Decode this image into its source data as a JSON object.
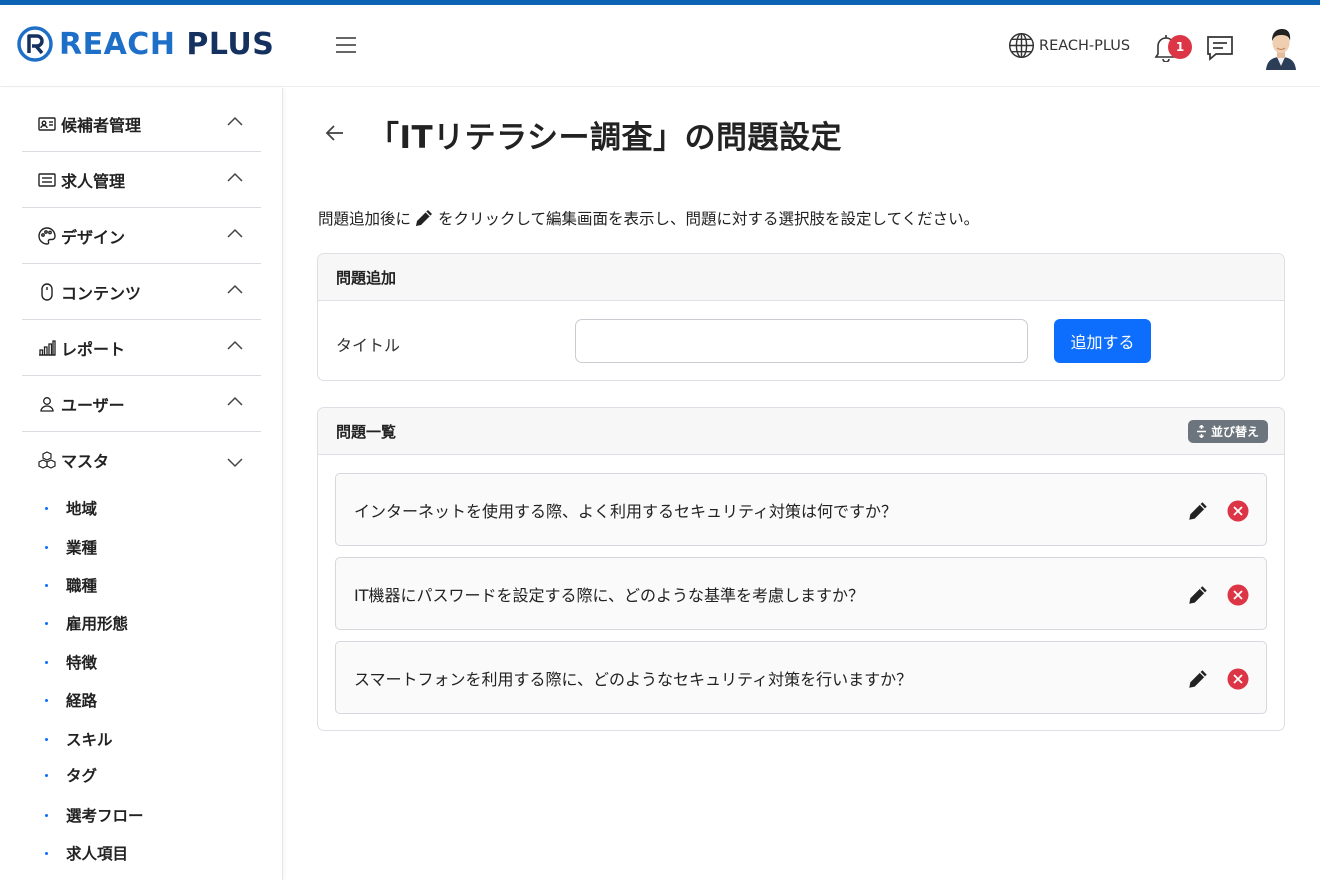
{
  "header": {
    "logo_reach": "REACH",
    "logo_plus": "PLUS",
    "org_name": "REACH-PLUS",
    "notification_count": "1"
  },
  "sidebar": {
    "items": [
      {
        "label": "候補者管理",
        "icon": "id-card-icon"
      },
      {
        "label": "求人管理",
        "icon": "list-icon"
      },
      {
        "label": "デザイン",
        "icon": "palette-icon"
      },
      {
        "label": "コンテンツ",
        "icon": "mouse-icon"
      },
      {
        "label": "レポート",
        "icon": "bar-chart-icon"
      },
      {
        "label": "ユーザー",
        "icon": "person-icon"
      },
      {
        "label": "マスタ",
        "icon": "boxes-icon"
      }
    ],
    "sub_items": [
      "地域",
      "業種",
      "職種",
      "雇用形態",
      "特徴",
      "経路",
      "スキル",
      "タグ",
      "選考フロー",
      "求人項目"
    ]
  },
  "page": {
    "title": "「ITリテラシー調査」の問題設定",
    "desc_before": "問題追加後に",
    "desc_after": "をクリックして編集画面を表示し、問題に対する選択肢を設定してください。"
  },
  "add_card": {
    "heading": "問題追加",
    "field_label": "タイトル",
    "input_value": "",
    "button_label": "追加する"
  },
  "list_card": {
    "heading": "問題一覧",
    "sort_label": "並び替え",
    "questions": [
      "インターネットを使用する際、よく利用するセキュリティ対策は何ですか？",
      "IT機器にパスワードを設定する際に、どのような基準を考慮しますか？",
      "スマートフォンを利用する際に、どのようなセキュリティ対策を行いますか？"
    ]
  },
  "colors": {
    "primary": "#0d6efd",
    "danger": "#dc3545",
    "top_line": "#0d63b3",
    "logo_blue": "#1e6fc7"
  }
}
